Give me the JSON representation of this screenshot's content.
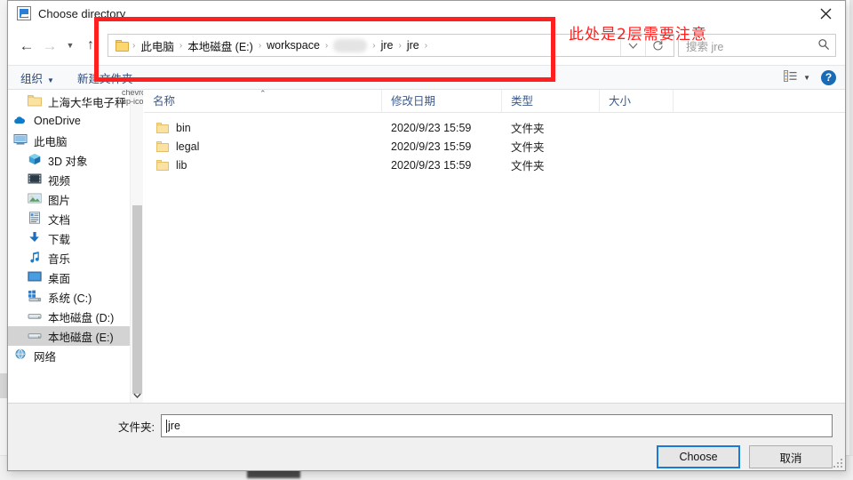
{
  "window": {
    "title": "Choose directory",
    "app_icon": "java-app-icon",
    "close_label": "✕"
  },
  "nav": {
    "back_icon": "arrow-left-icon",
    "forward_icon": "arrow-right-icon",
    "recent_icon": "chevron-down-icon",
    "up_icon": "arrow-up-icon",
    "breadcrumb": [
      {
        "label": "此电脑",
        "blurred": false
      },
      {
        "label": "本地磁盘 (E:)",
        "blurred": false
      },
      {
        "label": "workspace",
        "blurred": false
      },
      {
        "label": "",
        "blurred": true
      },
      {
        "label": "jre",
        "blurred": false
      },
      {
        "label": "jre",
        "blurred": false
      }
    ],
    "separator": "›",
    "dropdown_icon": "chevron-down-icon",
    "refresh_icon": "refresh-icon",
    "search_placeholder": "搜索 jre",
    "search_icon": "search-icon"
  },
  "commandbar": {
    "organize_label": "组织",
    "organize_caret": "▼",
    "new_folder_label": "新建文件夹",
    "view_icon": "view-list-icon",
    "view_caret": "▼",
    "help_label": "?"
  },
  "sidebar": {
    "items": [
      {
        "label": "上海大华电子秤",
        "icon": "folder-icon",
        "indent": 1,
        "selected": false
      },
      {
        "label": "OneDrive",
        "icon": "onedrive-cloud-icon",
        "indent": 0,
        "selected": false
      },
      {
        "label": "此电脑",
        "icon": "this-pc-icon",
        "indent": 0,
        "selected": false
      },
      {
        "label": "3D 对象",
        "icon": "3d-objects-icon",
        "indent": 1,
        "selected": false
      },
      {
        "label": "视频",
        "icon": "videos-icon",
        "indent": 1,
        "selected": false
      },
      {
        "label": "图片",
        "icon": "pictures-icon",
        "indent": 1,
        "selected": false
      },
      {
        "label": "文档",
        "icon": "documents-icon",
        "indent": 1,
        "selected": false
      },
      {
        "label": "下载",
        "icon": "downloads-icon",
        "indent": 1,
        "selected": false
      },
      {
        "label": "音乐",
        "icon": "music-icon",
        "indent": 1,
        "selected": false
      },
      {
        "label": "桌面",
        "icon": "desktop-icon",
        "indent": 1,
        "selected": false
      },
      {
        "label": "系统 (C:)",
        "icon": "windows-drive-icon",
        "indent": 1,
        "selected": false
      },
      {
        "label": "本地磁盘 (D:)",
        "icon": "drive-icon",
        "indent": 1,
        "selected": false
      },
      {
        "label": "本地磁盘 (E:)",
        "icon": "drive-icon",
        "indent": 1,
        "selected": true
      },
      {
        "label": "网络",
        "icon": "network-icon",
        "indent": 0,
        "selected": false
      }
    ],
    "scroll_up_icon": "chevron-up-icon",
    "scroll_down_icon": "chevron-down-icon"
  },
  "filelist": {
    "columns": [
      {
        "label": "名称",
        "key": "name"
      },
      {
        "label": "修改日期",
        "key": "date"
      },
      {
        "label": "类型",
        "key": "type"
      },
      {
        "label": "大小",
        "key": "size"
      }
    ],
    "sort_indicator": "⌃",
    "rows": [
      {
        "name": "bin",
        "date": "2020/9/23 15:59",
        "type": "文件夹",
        "size": ""
      },
      {
        "name": "legal",
        "date": "2020/9/23 15:59",
        "type": "文件夹",
        "size": ""
      },
      {
        "name": "lib",
        "date": "2020/9/23 15:59",
        "type": "文件夹",
        "size": ""
      }
    ]
  },
  "footer": {
    "folder_label": "文件夹:",
    "folder_value": "jre",
    "choose_label": "Choose",
    "cancel_label": "取消"
  },
  "annotation": {
    "note_text": "此处是2层需要注意",
    "color": "#ff1f1f"
  },
  "background": {
    "watermark": "",
    "status_text": ""
  }
}
